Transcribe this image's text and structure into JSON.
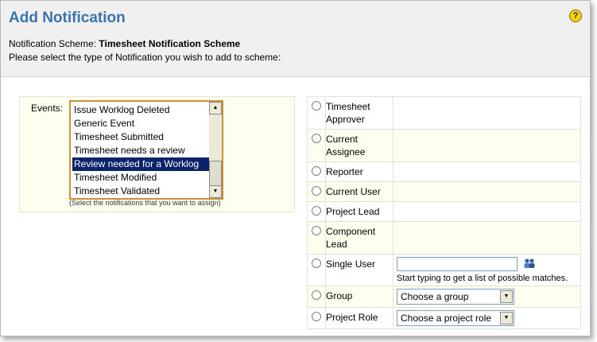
{
  "page": {
    "title": "Add Notification",
    "help_icon": "help-icon"
  },
  "scheme": {
    "label": "Notification Scheme:",
    "name": "Timesheet Notification Scheme",
    "instruction": "Please select the type of Notification you wish to add to scheme:"
  },
  "events": {
    "label": "Events:",
    "items": [
      {
        "label": "Issue Worklog Deleted",
        "selected": false
      },
      {
        "label": "Generic Event",
        "selected": false
      },
      {
        "label": "Timesheet Submitted",
        "selected": false
      },
      {
        "label": "Timesheet needs a review",
        "selected": false
      },
      {
        "label": "Review needed for a Worklog",
        "selected": true
      },
      {
        "label": "Timesheet Modified",
        "selected": false
      },
      {
        "label": "Timesheet Validated",
        "selected": false
      }
    ],
    "hint": "(Select the notifications that you want to assign)"
  },
  "types": [
    {
      "label": "Timesheet Approver"
    },
    {
      "label": "Current Assignee"
    },
    {
      "label": "Reporter"
    },
    {
      "label": "Current User"
    },
    {
      "label": "Project Lead"
    },
    {
      "label": "Component Lead"
    },
    {
      "label": "Single User",
      "hint": "Start typing to get a list of possible matches.",
      "icon": "user-picker-icon"
    },
    {
      "label": "Group",
      "select": "Choose a group"
    },
    {
      "label": "Project Role",
      "select": "Choose a project role"
    }
  ]
}
